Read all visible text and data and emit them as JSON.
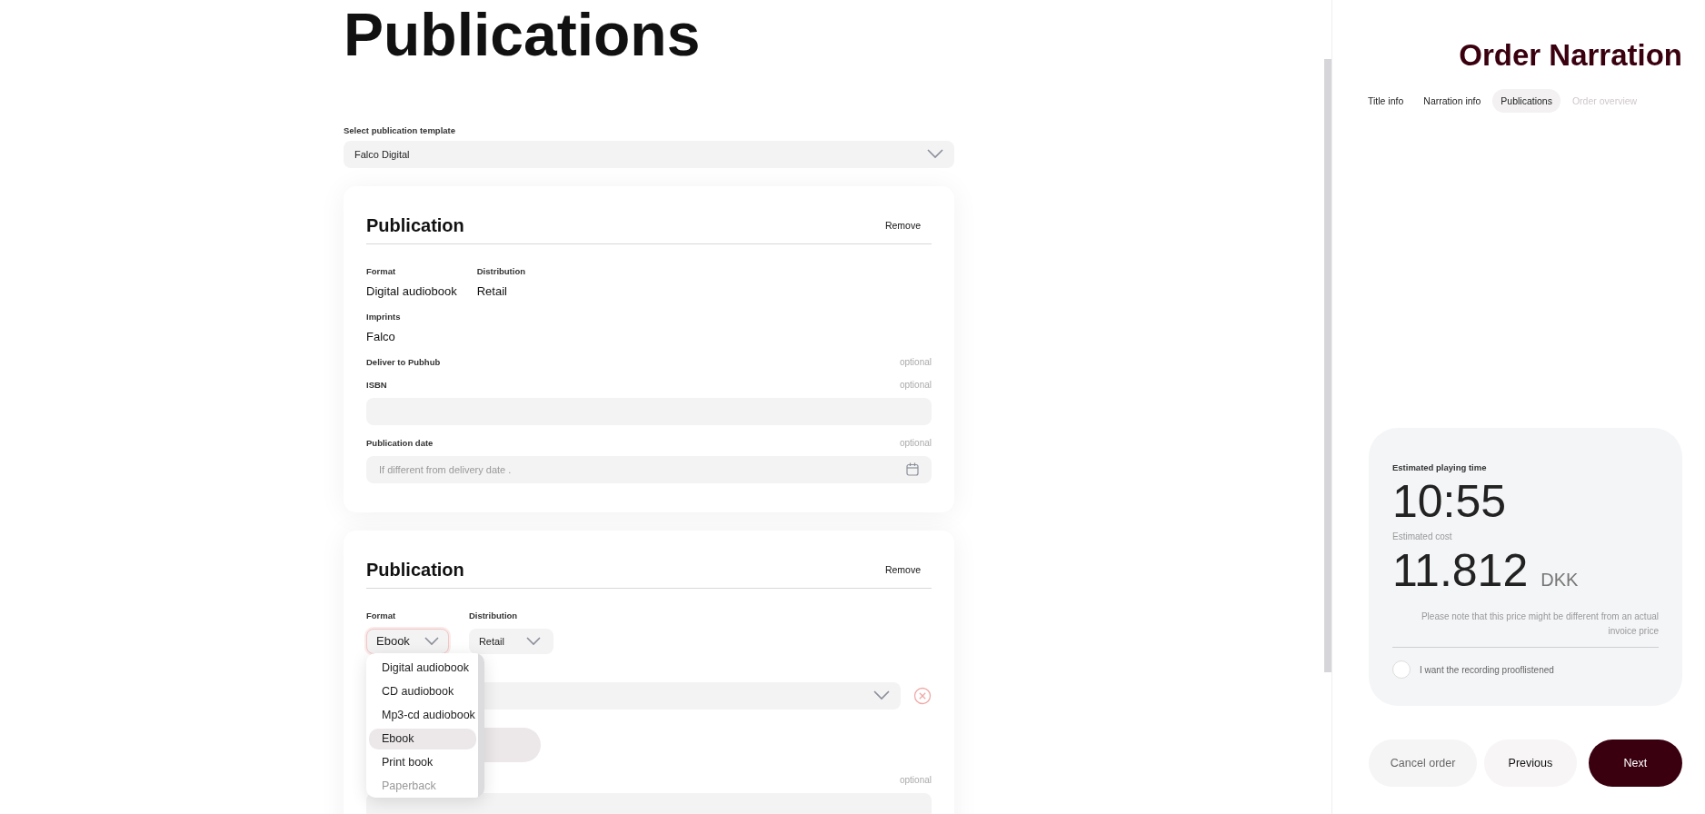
{
  "page_title": "Publications",
  "template": {
    "label": "Select publication template",
    "value": "Falco Digital"
  },
  "publications": [
    {
      "kind": "summary",
      "title": "Publication",
      "remove": "Remove",
      "format": {
        "label": "Format",
        "value": "Digital audiobook"
      },
      "distribution": {
        "label": "Distribution",
        "value": "Retail"
      },
      "imprints": {
        "label": "Imprints",
        "value": "Falco"
      },
      "fields": [
        {
          "kind": "plain",
          "label": "Deliver to Pubhub",
          "note": "optional"
        },
        {
          "kind": "text",
          "label": "ISBN",
          "note": "optional"
        },
        {
          "kind": "date",
          "label": "Publication date",
          "note": "optional",
          "placeholder": "If different from delivery date ."
        }
      ]
    },
    {
      "kind": "editing",
      "title": "Publication",
      "remove": "Remove",
      "format": {
        "label": "Format",
        "value": "Ebook",
        "expanded": true,
        "options": [
          {
            "label": "Digital audiobook",
            "selected": false,
            "disabled": false
          },
          {
            "label": "CD audiobook",
            "selected": false,
            "disabled": false
          },
          {
            "label": "Mp3-cd audiobook",
            "selected": false,
            "disabled": false
          },
          {
            "label": "Ebook",
            "selected": true,
            "disabled": false
          },
          {
            "label": "Print book",
            "selected": false,
            "disabled": false
          },
          {
            "label": "Paperback",
            "selected": false,
            "disabled": true
          }
        ]
      },
      "distribution": {
        "label": "Distribution",
        "value": "Retail"
      },
      "fields": [
        {
          "kind": "select-row"
        },
        {
          "kind": "add-pill"
        },
        {
          "kind": "text",
          "note": "optional"
        }
      ]
    }
  ],
  "side": {
    "title": "Order Narration",
    "steps": [
      {
        "label": "Title info",
        "selected": false,
        "disabled": false
      },
      {
        "label": "Narration info",
        "selected": false,
        "disabled": false
      },
      {
        "label": "Publications",
        "selected": true,
        "disabled": false
      },
      {
        "label": "Order overview",
        "selected": false,
        "disabled": true
      }
    ],
    "estimate": {
      "time_label": "Estimated playing time",
      "time": "10:55",
      "cost_label": "Estimated cost",
      "cost": "11.812",
      "currency": "DKK",
      "note": "Please note that this price might be different from an actual invoice price",
      "proof": {
        "label": "I want the recording prooflistened",
        "checked": false
      }
    },
    "buttons": [
      {
        "kind": "ghost",
        "label": "Cancel order"
      },
      {
        "kind": "secondary",
        "label": "Previous"
      },
      {
        "kind": "primary",
        "label": "Next"
      }
    ]
  }
}
